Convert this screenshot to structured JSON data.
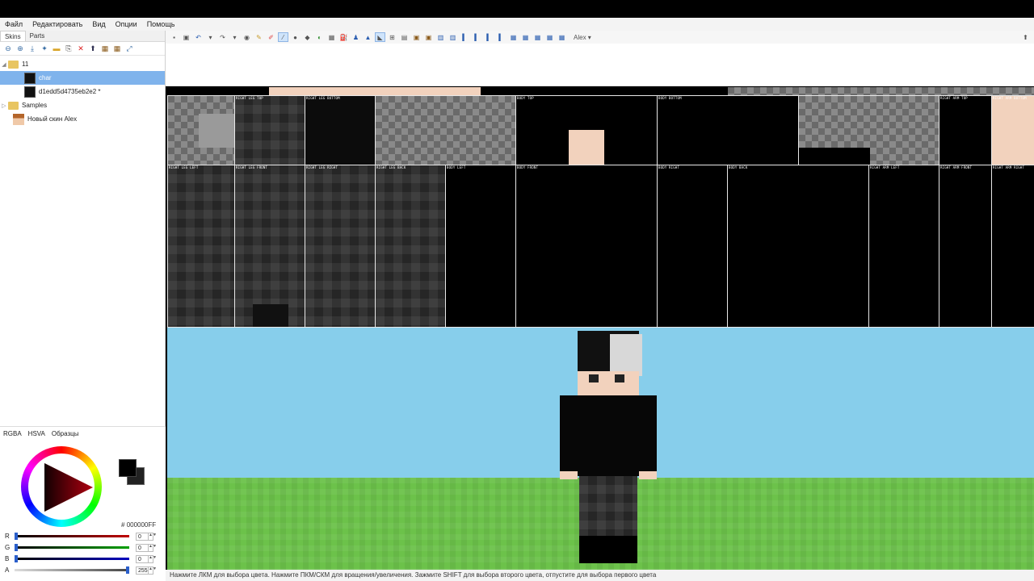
{
  "menu": [
    "Файл",
    "Редактировать",
    "Вид",
    "Опции",
    "Помощь"
  ],
  "left_tabs": [
    "Skins",
    "Parts"
  ],
  "tree": {
    "folder": "11",
    "items": [
      "char",
      "d1edd5d4735eb2e2 *"
    ],
    "samples": "Samples",
    "alex": "Новый скин Alex"
  },
  "color_tabs": [
    "RGBA",
    "HSVA",
    "Образцы"
  ],
  "color": {
    "hash": "#",
    "hex": "000000FF",
    "channels": [
      {
        "label": "R",
        "value": "0",
        "color": "#c00000"
      },
      {
        "label": "G",
        "value": "0",
        "color": "#00a000"
      },
      {
        "label": "B",
        "value": "0",
        "color": "#0000c0"
      },
      {
        "label": "A",
        "value": "255",
        "color": "#888888"
      }
    ]
  },
  "toolbar": {
    "model": "Alex"
  },
  "parts": {
    "right_leg_top": "RIGHT LEG TOP",
    "right_leg_bottom": "RIGHT LEG BOTTOM",
    "body_top": "BODY TOP",
    "body_bottom": "BODY BOTTOM",
    "right_arm_top": "RIGHT ARM TOP",
    "right_arm_bottom": "RIGHT ARM BOTTOM",
    "right_leg_left": "RIGHT LEG LEFT",
    "right_leg_front": "RIGHT LEG FRONT",
    "right_leg_right": "RIGHT LEG RIGHT",
    "right_leg_back": "RIGHT LEG BACK",
    "body_left": "BODY LEFT",
    "body_front": "BODY FRONT",
    "body_right": "BODY RIGHT",
    "body_back": "BODY BACK",
    "right_arm_left": "RIGHT ARM LEFT",
    "right_arm_front": "RIGHT ARM FRONT",
    "right_arm_right": "RIGHT ARM RIGHT"
  },
  "status": "Нажмите ЛКМ для выбора цвета. Нажмите ПКМ/СКМ для вращения/увеличения. Зажмите SHIFT для выбора второго цвета, отпустите для выбора первого цвета"
}
